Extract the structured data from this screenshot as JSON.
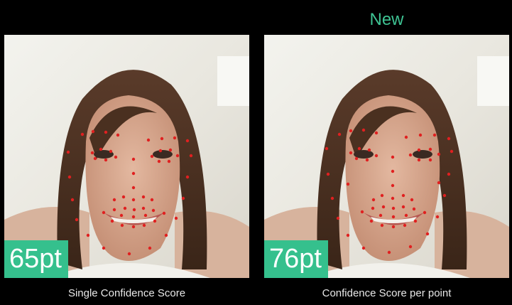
{
  "header": {
    "new_label": "New"
  },
  "panels": [
    {
      "score": "65pt",
      "caption": "Single Confidence Score"
    },
    {
      "score": "76pt",
      "caption": "Confidence Score per point"
    }
  ],
  "colors": {
    "accent": "#35c08d",
    "landmark": "#e02020",
    "background": "#000000"
  }
}
